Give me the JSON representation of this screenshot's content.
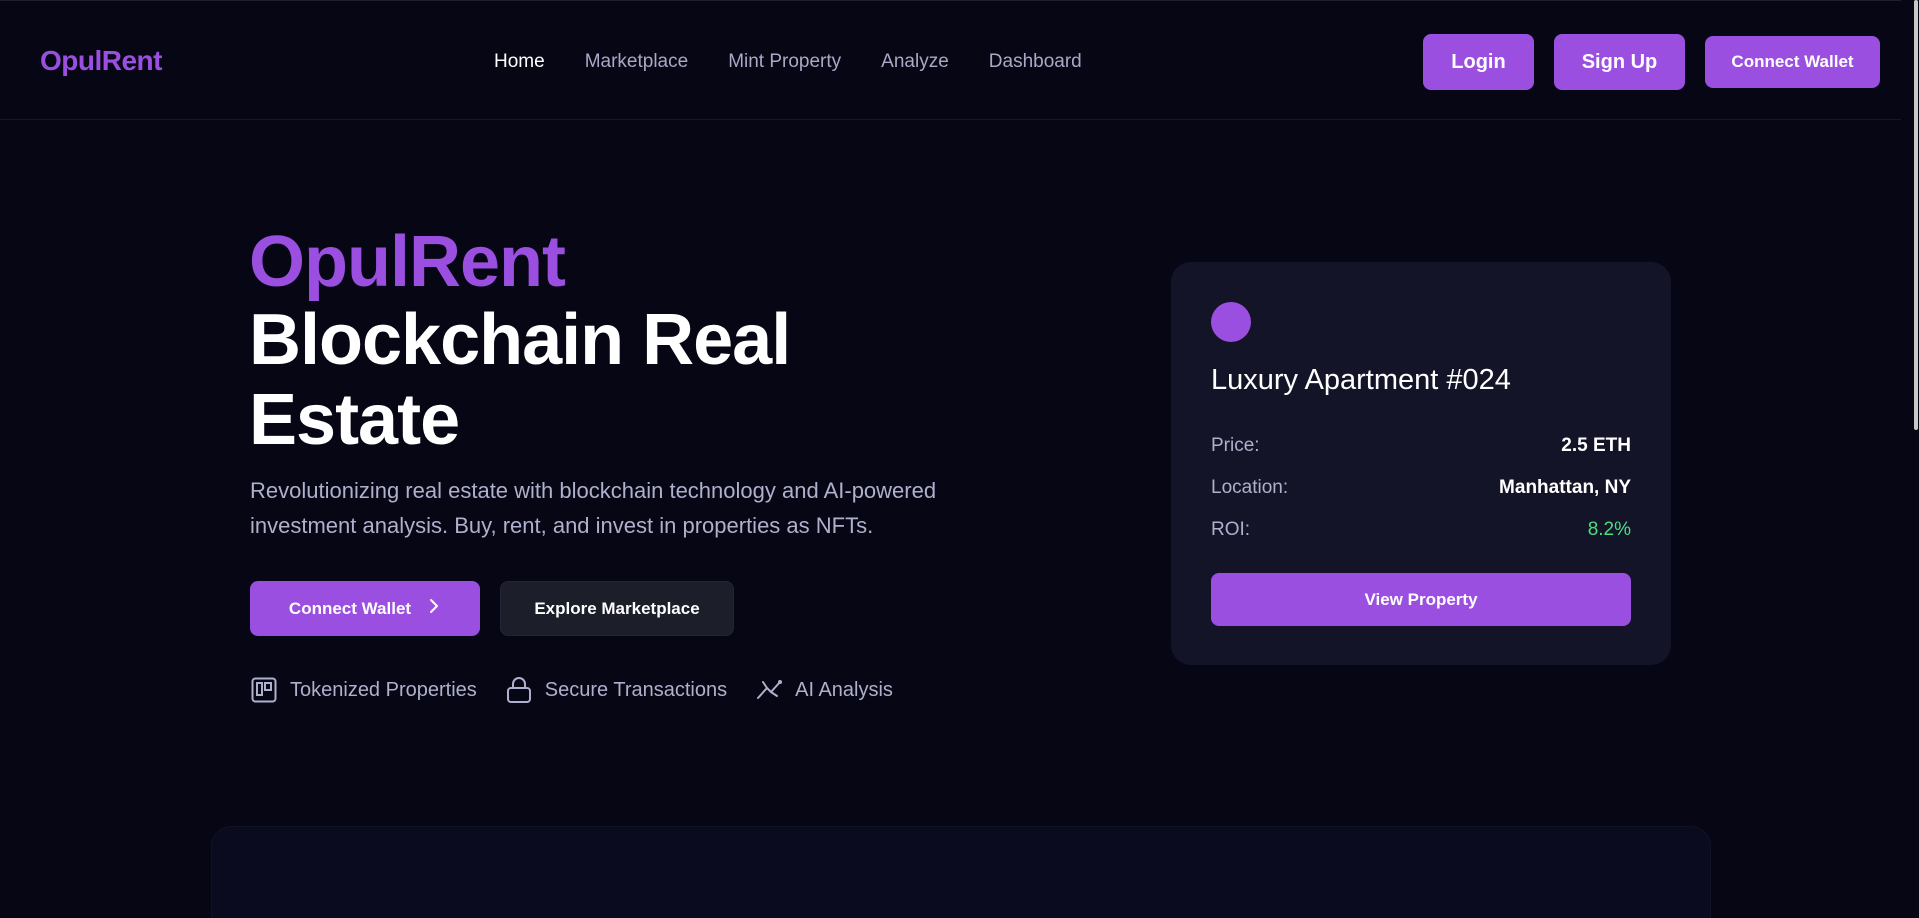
{
  "brand": {
    "logo": "OpulRent"
  },
  "nav": {
    "links": [
      "Home",
      "Marketplace",
      "Mint Property",
      "Analyze",
      "Dashboard"
    ],
    "login": "Login",
    "signup": "Sign Up",
    "connect_wallet": "Connect Wallet"
  },
  "hero": {
    "title_brand": "OpulRent",
    "title_main": "Blockchain Real Estate",
    "description": "Revolutionizing real estate with blockchain technology and AI-powered investment analysis. Buy, rent, and invest in properties as NFTs.",
    "cta_primary": "Connect Wallet",
    "cta_secondary": "Explore Marketplace",
    "features": [
      {
        "label": "Tokenized Properties",
        "icon": "token-icon"
      },
      {
        "label": "Secure Transactions",
        "icon": "lock-icon"
      },
      {
        "label": "AI Analysis",
        "icon": "ai-icon"
      }
    ]
  },
  "property_card": {
    "title": "Luxury Apartment #024",
    "rows": [
      {
        "label": "Price:",
        "value": "2.5 ETH"
      },
      {
        "label": "Location:",
        "value": "Manhattan, NY"
      },
      {
        "label": "ROI:",
        "value": "8.2%"
      }
    ],
    "button": "View Property"
  },
  "colors": {
    "accent": "#9b4fe0",
    "background": "#060614",
    "card": "#141428",
    "positive": "#4ade80"
  }
}
